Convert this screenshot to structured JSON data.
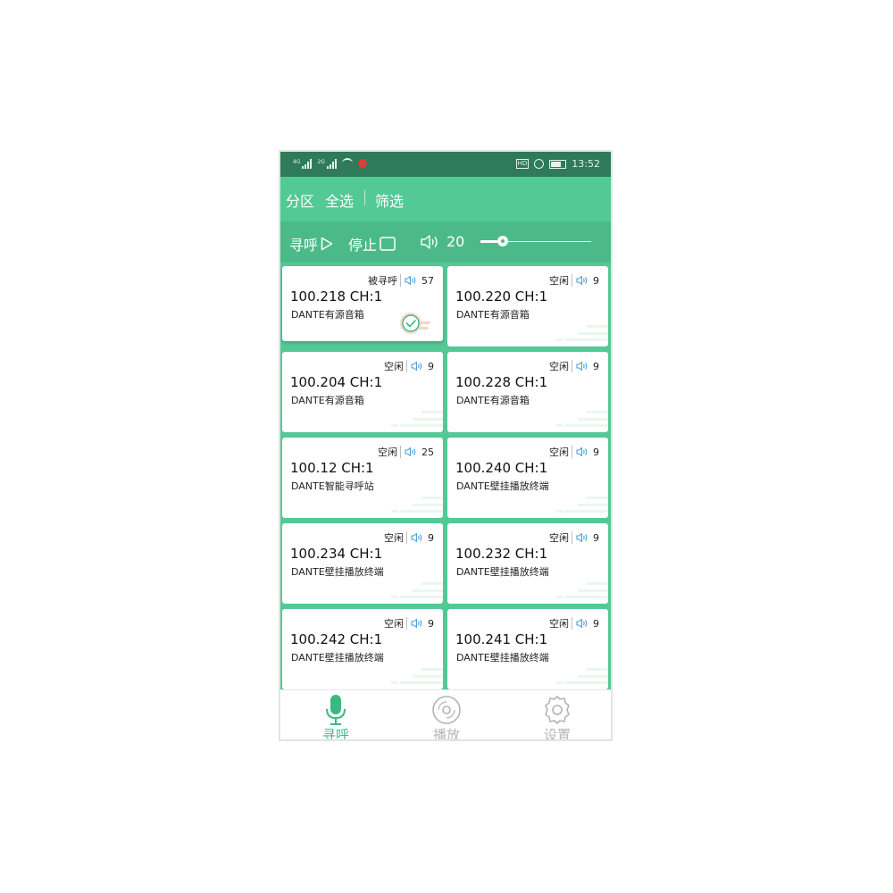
{
  "statusbar": {
    "signal1_tag": "4G",
    "signal2_tag": "2G",
    "time": "13:52",
    "hd_badge": "HD"
  },
  "topbar": {
    "zone": "分区",
    "select_all": "全选",
    "filter": "筛选"
  },
  "controls": {
    "page_label": "寻呼",
    "stop_label": "停止",
    "volume": "20",
    "volume_level": 20,
    "volume_max": 100
  },
  "cards": [
    {
      "status": "被寻呼",
      "volume": "57",
      "title": "100.218 CH:1",
      "subtitle": "DANTE有源音箱",
      "selected": true
    },
    {
      "status": "空闲",
      "volume": "9",
      "title": "100.220 CH:1",
      "subtitle": "DANTE有源音箱",
      "selected": false
    },
    {
      "status": "空闲",
      "volume": "9",
      "title": "100.204 CH:1",
      "subtitle": "DANTE有源音箱",
      "selected": false
    },
    {
      "status": "空闲",
      "volume": "9",
      "title": "100.228 CH:1",
      "subtitle": "DANTE有源音箱",
      "selected": false
    },
    {
      "status": "空闲",
      "volume": "25",
      "title": "100.12 CH:1",
      "subtitle": "DANTE智能寻呼站",
      "selected": false
    },
    {
      "status": "空闲",
      "volume": "9",
      "title": "100.240 CH:1",
      "subtitle": "DANTE壁挂播放终端",
      "selected": false
    },
    {
      "status": "空闲",
      "volume": "9",
      "title": "100.234 CH:1",
      "subtitle": "DANTE壁挂播放终端",
      "selected": false
    },
    {
      "status": "空闲",
      "volume": "9",
      "title": "100.232 CH:1",
      "subtitle": "DANTE壁挂播放终端",
      "selected": false
    },
    {
      "status": "空闲",
      "volume": "9",
      "title": "100.242 CH:1",
      "subtitle": "DANTE壁挂播放终端",
      "selected": false
    },
    {
      "status": "空闲",
      "volume": "9",
      "title": "100.241 CH:1",
      "subtitle": "DANTE壁挂播放终端",
      "selected": false
    }
  ],
  "bottomnav": {
    "page": "寻呼",
    "play": "播放",
    "settings": "设置",
    "active": "page"
  },
  "colors": {
    "primary": "#53c995",
    "statusbar": "#2f7a58",
    "controls_bg": "#4cba88",
    "active_tab": "#3cb883",
    "speaker_icon": "#4a9fd8",
    "check_badge": "#f5a48e"
  }
}
